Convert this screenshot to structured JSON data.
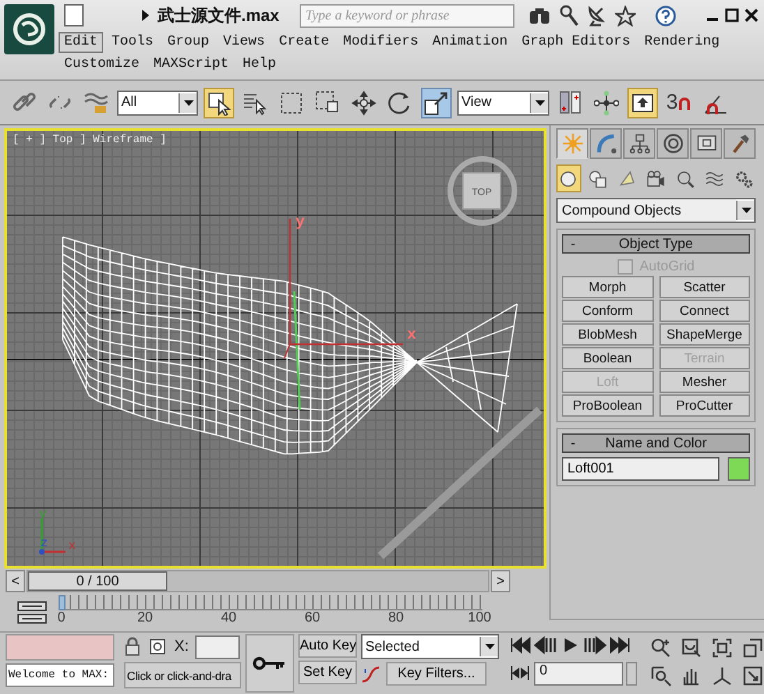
{
  "title_bar": {
    "file_title": "武士源文件.max",
    "search": {
      "placeholder": "Type a keyword or phrase"
    }
  },
  "menu": [
    {
      "label": "Edit",
      "selected": true
    },
    {
      "label": "Tools",
      "selected": false
    },
    {
      "label": "Group",
      "selected": false
    },
    {
      "label": "Views",
      "selected": false
    },
    {
      "label": "Create",
      "selected": false
    },
    {
      "label": "Modifiers",
      "selected": false
    },
    {
      "label": "Animation",
      "selected": false
    },
    {
      "label": "Graph Editors",
      "selected": false
    },
    {
      "label": "Rendering",
      "selected": false
    },
    {
      "label": "Customize",
      "selected": false
    },
    {
      "label": "MAXScript",
      "selected": false
    },
    {
      "label": "Help",
      "selected": false
    }
  ],
  "toolbar": {
    "selection_filter": "All",
    "reference_coord": "View",
    "snap_label": "3",
    "select_object_active": true,
    "scale_active": true,
    "manipulate_active": true
  },
  "viewport": {
    "label": "[ + ] Top ] Wireframe ]",
    "viewcube_label": "TOP",
    "gizmo_labels": [
      "y",
      "x"
    ],
    "tripod_labels": [
      "y",
      "z",
      "x"
    ],
    "active": true
  },
  "command_panel": {
    "tabs": [
      {
        "selected": true
      },
      {
        "selected": false
      },
      {
        "selected": false
      },
      {
        "selected": false
      },
      {
        "selected": false
      },
      {
        "selected": false
      }
    ],
    "categories": [
      {
        "selected": true
      },
      {
        "selected": false
      },
      {
        "selected": false
      },
      {
        "selected": false
      },
      {
        "selected": false
      },
      {
        "selected": false
      },
      {
        "selected": false
      }
    ],
    "dropdown": "Compound Objects",
    "object_type": {
      "title": "Object Type",
      "collapse": "-",
      "autogrid": {
        "label": "AutoGrid",
        "checked": false,
        "disabled": true
      },
      "buttons": [
        {
          "label": "Morph",
          "disabled": false
        },
        {
          "label": "Scatter",
          "disabled": false
        },
        {
          "label": "Conform",
          "disabled": false
        },
        {
          "label": "Connect",
          "disabled": false
        },
        {
          "label": "BlobMesh",
          "disabled": false
        },
        {
          "label": "ShapeMerge",
          "disabled": false
        },
        {
          "label": "Boolean",
          "disabled": false
        },
        {
          "label": "Terrain",
          "disabled": true
        },
        {
          "label": "Loft",
          "disabled": true
        },
        {
          "label": "Mesher",
          "disabled": false
        },
        {
          "label": "ProBoolean",
          "disabled": false
        },
        {
          "label": "ProCutter",
          "disabled": false
        }
      ]
    },
    "name_and_color": {
      "title": "Name and Color",
      "collapse": "-",
      "name": "Loft001",
      "color": "#7ed957"
    }
  },
  "time_slider": {
    "prev": "<",
    "reading": "0 / 100",
    "next": ">",
    "level": 0
  },
  "track_bar": {
    "ticks": [
      "0",
      "20",
      "40",
      "60",
      "80",
      "100"
    ]
  },
  "status": {
    "listener_output": "Welcome to MAX:",
    "prompt": "Click or click-and-dra",
    "x_label": "X:",
    "auto_key": "Auto Key",
    "set_key": "Set Key",
    "key_mode": "Selected",
    "key_filters": "Key Filters...",
    "frame": "0"
  }
}
